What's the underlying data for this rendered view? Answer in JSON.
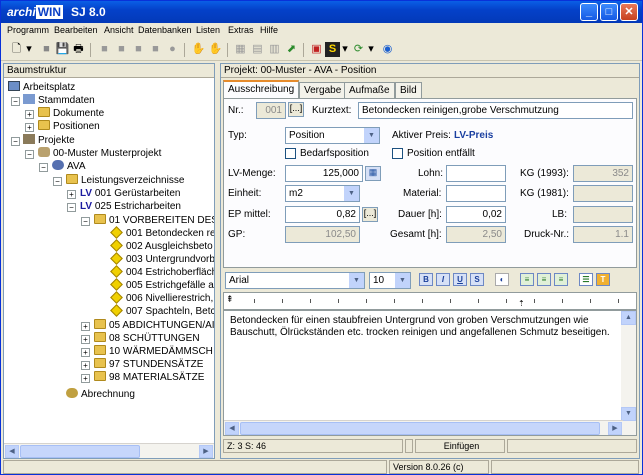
{
  "app": {
    "title_brand": "archi",
    "title_brand_b": "WIN",
    "title_version": "SJ 8.0"
  },
  "menu": [
    "Programm",
    "Bearbeiten",
    "Ansicht",
    "Datenbanken",
    "Listen",
    "Extras",
    "Hilfe"
  ],
  "left": {
    "header": "Baumstruktur",
    "tree": [
      {
        "label": "Arbeitsplatz"
      },
      {
        "label": "Stammdaten"
      },
      {
        "label": "Dokumente"
      },
      {
        "label": "Positionen"
      },
      {
        "label": "Projekte"
      },
      {
        "label": "00-Muster Musterprojekt"
      },
      {
        "label": "AVA"
      },
      {
        "label": "Leistungsverzeichnisse"
      },
      {
        "prefix": "LV",
        "label": "001 Gerüstarbeiten"
      },
      {
        "prefix": "LV",
        "label": "025 Estricharbeiten"
      },
      {
        "label": "01 VORBEREITEN DES"
      },
      {
        "label": "001 Betondecken re"
      },
      {
        "label": "002 Ausgleichsbeto"
      },
      {
        "label": "003 Untergrundvorbe"
      },
      {
        "label": "004 Estrichoberfläch"
      },
      {
        "label": "005 Estrichgefälle a"
      },
      {
        "label": "006 Nivellierestrich,"
      },
      {
        "label": "007 Spachteln, Betc"
      },
      {
        "label": "05 ABDICHTUNGEN/AI"
      },
      {
        "label": "08 SCHÜTTUNGEN"
      },
      {
        "label": "10 WÄRMEDÄMMSCH"
      },
      {
        "label": "97 STUNDENSÄTZE"
      },
      {
        "label": "98 MATERIALSÄTZE"
      },
      {
        "label": "Abrechnung"
      }
    ]
  },
  "right": {
    "header": "Projekt: 00-Muster - AVA - Position",
    "tabs": [
      "Ausschreibung",
      "Vergabe",
      "Aufmaße",
      "Bild"
    ],
    "form": {
      "nr_label": "Nr.:",
      "nr_value": "001",
      "dots": "[...]",
      "kurztext_label": "Kurztext:",
      "kurztext_value": "Betondecken reinigen,grobe Verschmutzung",
      "typ_label": "Typ:",
      "typ_value": "Position",
      "aktiver_preis_label": "Aktiver Preis:",
      "aktiver_preis_value": "LV-Preis",
      "bedarfsposition": "Bedarfsposition",
      "position_entfallt": "Position entfällt",
      "lv_menge_label": "LV-Menge:",
      "lv_menge_value": "125,000",
      "lohn_label": "Lohn:",
      "lohn_value": "",
      "kg1993_label": "KG (1993):",
      "kg1993_value": "352",
      "einheit_label": "Einheit:",
      "einheit_value": "m2",
      "material_label": "Material:",
      "material_value": "",
      "kg1981_label": "KG (1981):",
      "kg1981_value": "",
      "ep_label": "EP mittel:",
      "ep_value": "0,82",
      "dauer_label": "Dauer [h]:",
      "dauer_value": "0,02",
      "lb_label": "LB:",
      "lb_value": "",
      "gp_label": "GP:",
      "gp_value": "102,50",
      "gesamt_label": "Gesamt [h]:",
      "gesamt_value": "2,50",
      "druck_label": "Druck-Nr.:",
      "druck_value": "1.1"
    },
    "format": {
      "font": "Arial",
      "size": "10"
    },
    "editor_text": "Betondecken für einen staubfreien Untergrund von groben Verschmutzungen wie Bauschutt, Ölrückständen etc. trocken reinigen und angefallenen Schmutz beseitigen.",
    "status": {
      "z": "Z:  3  S:  46",
      "mode": "Einfügen"
    }
  },
  "footer": {
    "version": "Version 8.0.26 (c)"
  }
}
